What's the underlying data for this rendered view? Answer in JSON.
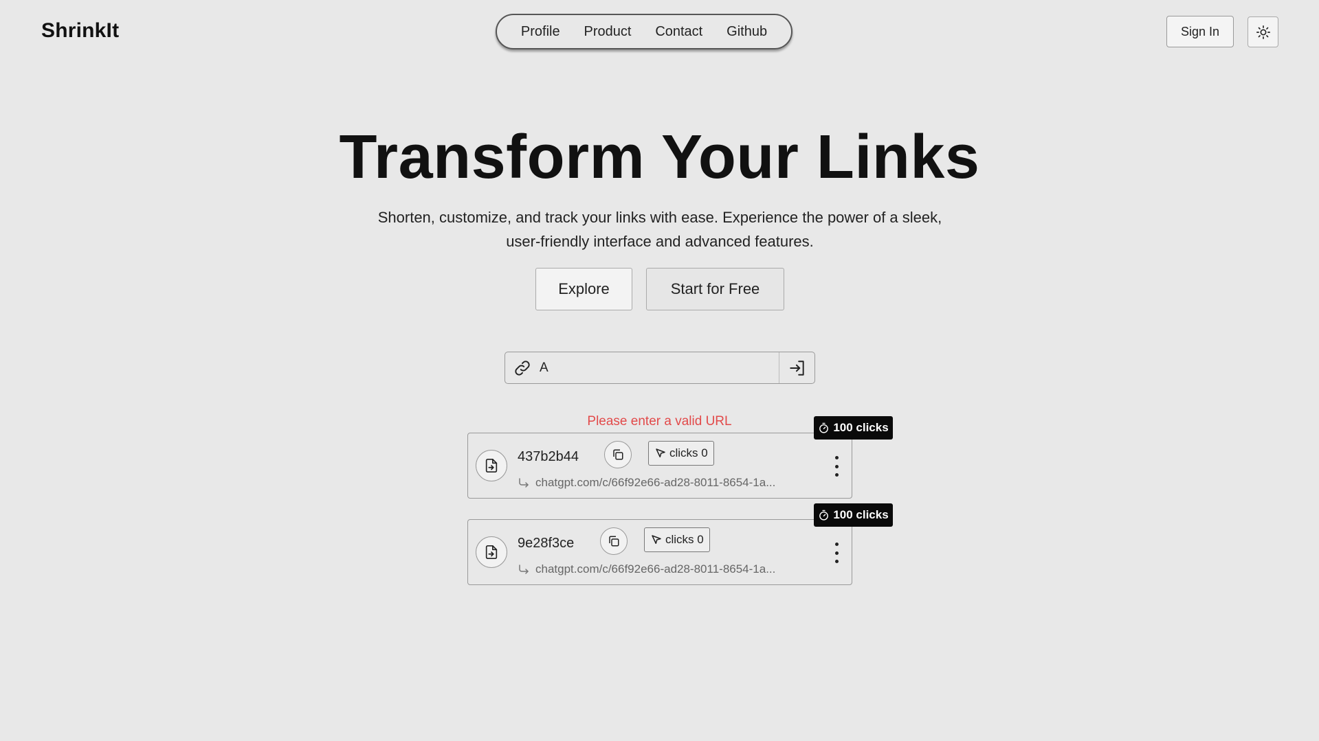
{
  "header": {
    "brand": "ShrinkIt",
    "nav": [
      "Profile",
      "Product",
      "Contact",
      "Github"
    ],
    "sign_in": "Sign In",
    "theme_icon": "sun-icon"
  },
  "hero": {
    "title": "Transform Your Links",
    "subtitle": "Shorten, customize, and track your links with ease. Experience the power of a sleek, user-friendly interface and advanced features.",
    "explore": "Explore",
    "start": "Start for Free"
  },
  "shortener": {
    "input_value": "A",
    "link_icon": "link-icon",
    "submit_icon": "sign-in-arrow-icon",
    "error": "Please enter a valid URL"
  },
  "links": [
    {
      "code": "437b2b44",
      "clicks_label": "clicks 0",
      "destination": "chatgpt.com/c/66f92e66-ad28-8011-8654-1a...",
      "limit": "100 clicks"
    },
    {
      "code": "9e28f3ce",
      "clicks_label": "clicks 0",
      "destination": "chatgpt.com/c/66f92e66-ad28-8011-8654-1a...",
      "limit": "100 clicks"
    }
  ],
  "colors": {
    "background": "#e8e8e8",
    "error": "#e24a4a",
    "badge": "#0a0a0a"
  }
}
